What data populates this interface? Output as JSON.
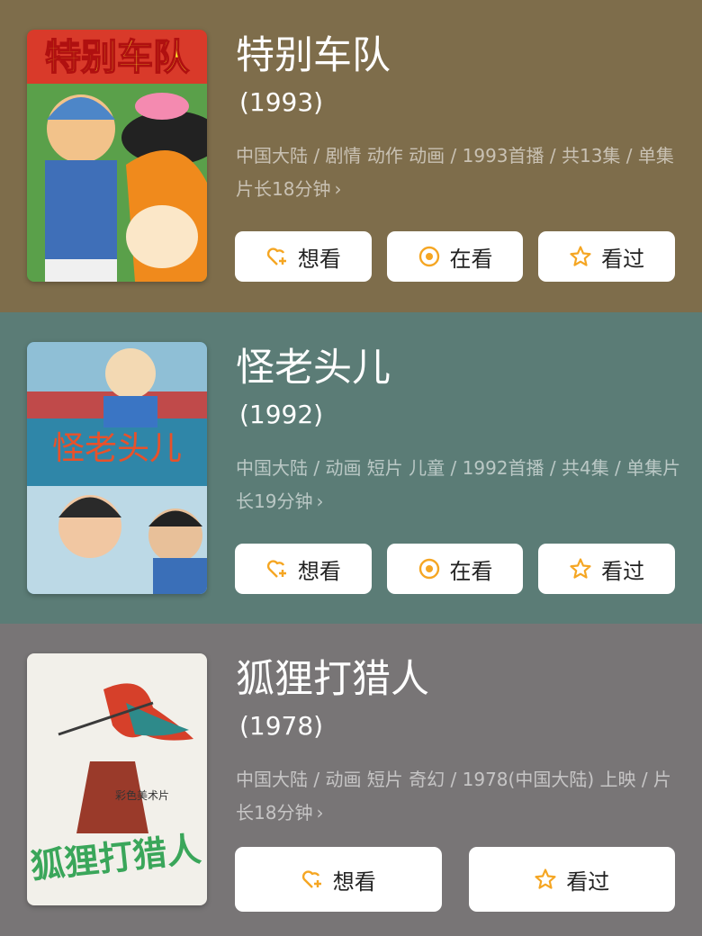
{
  "colors": {
    "card1_bg": "#7e6d4b",
    "card2_bg": "#5b7c76",
    "card3_bg": "#787576",
    "accent": "#f5a623"
  },
  "items": [
    {
      "title": "特别车队",
      "year": "(1993)",
      "meta": "中国大陆 / 剧情 动作 动画 / 1993首播 / 共13集 / 单集片长18分钟",
      "poster_text": "特别车队",
      "buttons": [
        {
          "label": "想看",
          "icon": "heart-plus-icon"
        },
        {
          "label": "在看",
          "icon": "target-icon"
        },
        {
          "label": "看过",
          "icon": "star-icon"
        }
      ]
    },
    {
      "title": "怪老头儿",
      "year": "(1992)",
      "meta": "中国大陆 / 动画 短片 儿童 / 1992首播 / 共4集 / 单集片长19分钟",
      "poster_text": "怪老头儿",
      "buttons": [
        {
          "label": "想看",
          "icon": "heart-plus-icon"
        },
        {
          "label": "在看",
          "icon": "target-icon"
        },
        {
          "label": "看过",
          "icon": "star-icon"
        }
      ]
    },
    {
      "title": "狐狸打猎人",
      "year": "(1978)",
      "meta": "中国大陆 / 动画 短片 奇幻 / 1978(中国大陆) 上映 / 片长18分钟",
      "poster_text": "狐狸打猎人",
      "poster_subtext": "彩色美术片",
      "buttons": [
        {
          "label": "想看",
          "icon": "heart-plus-icon"
        },
        {
          "label": "看过",
          "icon": "star-icon"
        }
      ]
    }
  ]
}
